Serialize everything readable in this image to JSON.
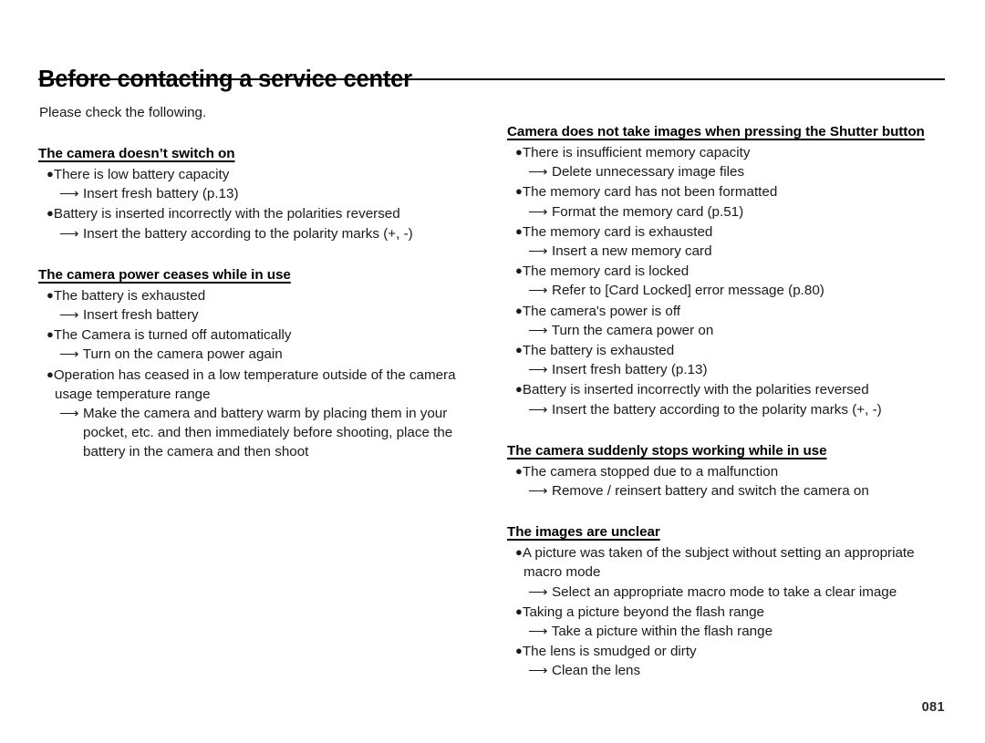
{
  "document": {
    "title": "Before contacting a service center",
    "intro": "Please check the following.",
    "page_number": "081"
  },
  "left_column": {
    "sections": [
      {
        "heading": "The camera doesn’t switch on",
        "items": [
          {
            "bullet": "There is low battery capacity",
            "arrow": "Insert fresh battery (p.13)"
          },
          {
            "bullet": "Battery is inserted incorrectly with the polarities reversed",
            "arrow": "Insert the battery according to the polarity marks (+, -)"
          }
        ]
      },
      {
        "heading": "The camera power ceases while in use",
        "items": [
          {
            "bullet": "The battery is exhausted",
            "arrow": "Insert fresh battery"
          },
          {
            "bullet": "The Camera is turned off automatically",
            "arrow": "Turn on the camera power again"
          },
          {
            "bullet": "Operation has ceased in a low temperature outside of the camera usage temperature range",
            "arrow": "Make the camera and battery warm by placing them in your pocket, etc. and then immediately before shooting, place the battery in the camera and then shoot"
          }
        ]
      }
    ]
  },
  "right_column": {
    "sections": [
      {
        "heading": "Camera does not take images when pressing the Shutter button",
        "items": [
          {
            "bullet": "There is insufficient memory capacity",
            "arrow": "Delete unnecessary image files"
          },
          {
            "bullet": "The memory card has not been formatted",
            "arrow": "Format the memory card (p.51)"
          },
          {
            "bullet": "The memory card is exhausted",
            "arrow": "Insert a new memory card"
          },
          {
            "bullet": "The memory card is locked",
            "arrow": "Refer to [Card Locked] error message (p.80)"
          },
          {
            "bullet": "The camera's power is off",
            "arrow": "Turn the camera power on"
          },
          {
            "bullet": "The battery is exhausted",
            "arrow": "Insert fresh battery (p.13)"
          },
          {
            "bullet": "Battery is inserted incorrectly with the polarities reversed",
            "arrow": "Insert the battery according to the polarity marks (+, -)"
          }
        ]
      },
      {
        "heading": "The camera suddenly stops working while in use",
        "items": [
          {
            "bullet": "The camera stopped due to a malfunction",
            "arrow": "Remove / reinsert battery and switch the camera on"
          }
        ]
      },
      {
        "heading": "The images are unclear",
        "items": [
          {
            "bullet": "A picture was taken of the subject without setting an appropriate macro mode",
            "arrow": "Select an appropriate macro mode to take a clear image"
          },
          {
            "bullet": "Taking a picture beyond the flash range",
            "arrow": "Take a picture within the flash range"
          },
          {
            "bullet": "The lens is smudged or dirty",
            "arrow": "Clean the lens"
          }
        ]
      }
    ]
  },
  "glyphs": {
    "bullet": "●",
    "arrow": "⟶"
  }
}
